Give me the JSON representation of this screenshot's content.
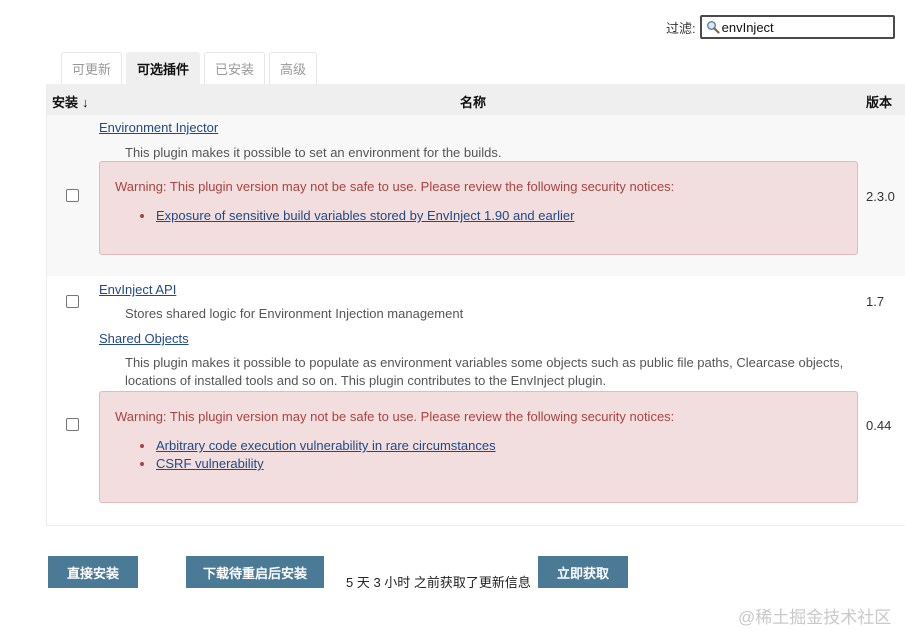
{
  "filter": {
    "label": "过滤:",
    "value": "envInject"
  },
  "tabs": [
    {
      "label": "可更新",
      "active": false
    },
    {
      "label": "可选插件",
      "active": true
    },
    {
      "label": "已安装",
      "active": false
    },
    {
      "label": "高级",
      "active": false
    }
  ],
  "table": {
    "headers": {
      "install": "安装",
      "sort_indicator": "↓",
      "name": "名称",
      "version": "版本"
    },
    "plugins": [
      {
        "name": "Environment Injector",
        "description": "This plugin makes it possible to set an environment for the builds.",
        "version": "2.3.0",
        "checked": false,
        "warning": {
          "text": "Warning: This plugin version may not be safe to use. Please review the following security notices:",
          "notices": [
            "Exposure of sensitive build variables stored by EnvInject 1.90 and earlier"
          ]
        }
      },
      {
        "name": "EnvInject API",
        "description": "Stores shared logic for Environment Injection management",
        "version": "1.7",
        "checked": false
      },
      {
        "name": "Shared Objects",
        "description_line1": "This plugin makes it possible to populate as environment variables some objects such as public file paths, Clearcase objects,",
        "description_line2": "locations of installed tools and so on. This plugin contributes to the EnvInject plugin.",
        "version": "0.44",
        "checked": false,
        "warning": {
          "text": "Warning: This plugin version may not be safe to use. Please review the following security notices:",
          "notices": [
            "Arbitrary code execution vulnerability in rare circumstances",
            "CSRF vulnerability"
          ]
        }
      }
    ]
  },
  "actions": {
    "install_now": "直接安装",
    "download_restart": "下载待重启后安装",
    "updated_info": "5 天 3 小时 之前获取了更新信息",
    "check_now": "立即获取"
  },
  "watermark": "@稀土掘金技术社区",
  "colors": {
    "button": "#4a7a96",
    "warning_bg": "#f2dede",
    "warning_text": "#a94442",
    "link": "#204a87"
  }
}
